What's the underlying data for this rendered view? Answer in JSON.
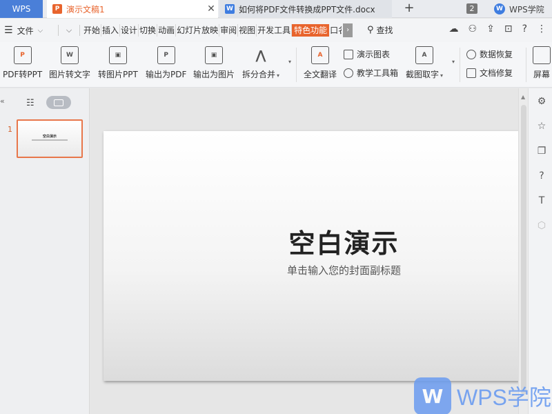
{
  "titlebar": {
    "home_label": "WPS",
    "active_tab": {
      "title": "演示文稿1",
      "icon": "P"
    },
    "doc_tab": {
      "title": "如何将PDF文件转换成PPT文件.docx",
      "icon": "W"
    },
    "close_glyph": "✕",
    "plus_glyph": "+",
    "counter": "2",
    "academy_label": "WPS学院",
    "academy_icon": "W"
  },
  "menubar": {
    "file_label": "文件",
    "items": [
      "开始",
      "插入",
      "设计",
      "切换",
      "动画",
      "幻灯片放映",
      "审阅",
      "视图",
      "开发工具"
    ],
    "special_item": "特色功能",
    "overflow_item": "口名",
    "search_label": "查找"
  },
  "ribbon": {
    "large": [
      {
        "label": "PDF转PPT",
        "icon": "P"
      },
      {
        "label": "图片转文字",
        "icon": "W"
      },
      {
        "label": "转图片PPT",
        "icon": "▣"
      },
      {
        "label": "输出为PDF",
        "icon": "P"
      },
      {
        "label": "输出为图片",
        "icon": "▣"
      },
      {
        "label": "拆分合并",
        "icon": "⋀"
      },
      {
        "label": "全文翻译",
        "icon": "A"
      },
      {
        "label": "截图取字",
        "icon": "A"
      },
      {
        "label": "屏幕",
        "icon": ""
      }
    ],
    "small": [
      "演示图表",
      "教学工具箱",
      "数据恢复",
      "文档修复"
    ]
  },
  "slide": {
    "number": "1",
    "title": "空白演示",
    "subtitle": "单击输入您的封面副标题"
  },
  "watermark": {
    "logo": "W",
    "text": "WPS学院"
  }
}
